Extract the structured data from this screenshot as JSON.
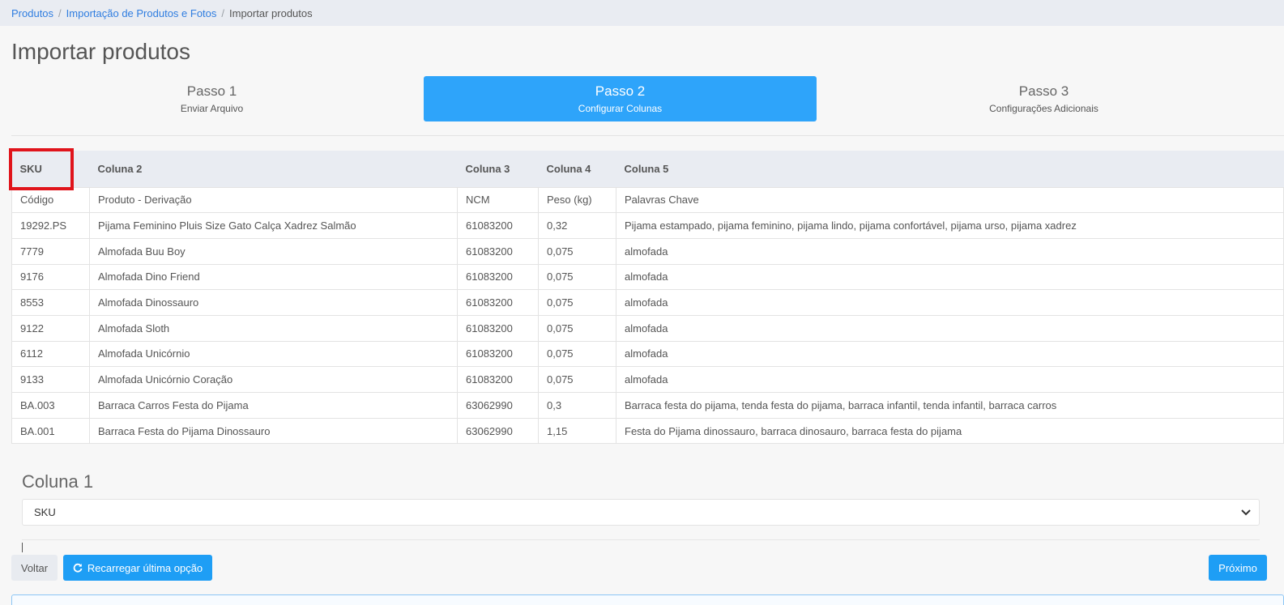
{
  "breadcrumb": {
    "items": [
      {
        "label": "Produtos"
      },
      {
        "label": "Importação de Produtos e Fotos"
      },
      {
        "label": "Importar produtos"
      }
    ]
  },
  "page": {
    "title": "Importar produtos"
  },
  "steps": [
    {
      "number": "Passo 1",
      "label": "Enviar Arquivo",
      "active": false
    },
    {
      "number": "Passo 2",
      "label": "Configurar Colunas",
      "active": true
    },
    {
      "number": "Passo 3",
      "label": "Configurações Adicionais",
      "active": false
    }
  ],
  "table": {
    "headers": [
      "SKU",
      "Coluna 2",
      "Coluna 3",
      "Coluna 4",
      "Coluna 5"
    ],
    "rows": [
      [
        "Código",
        "Produto - Derivação",
        "NCM",
        "Peso (kg)",
        "Palavras Chave"
      ],
      [
        "19292.PS",
        "Pijama Feminino Pluis Size Gato Calça Xadrez Salmão",
        "61083200",
        "0,32",
        "Pijama estampado, pijama feminino, pijama lindo, pijama confortável, pijama urso, pijama xadrez"
      ],
      [
        "7779",
        "Almofada Buu Boy",
        "61083200",
        "0,075",
        "almofada"
      ],
      [
        "9176",
        "Almofada Dino Friend",
        "61083200",
        "0,075",
        "almofada"
      ],
      [
        "8553",
        "Almofada Dinossauro",
        "61083200",
        "0,075",
        "almofada"
      ],
      [
        "9122",
        "Almofada Sloth",
        "61083200",
        "0,075",
        "almofada"
      ],
      [
        "6112",
        "Almofada Unicórnio",
        "61083200",
        "0,075",
        "almofada"
      ],
      [
        "9133",
        "Almofada Unicórnio Coração",
        "61083200",
        "0,075",
        "almofada"
      ],
      [
        "BA.003",
        "Barraca Carros Festa do Pijama",
        "63062990",
        "0,3",
        "Barraca festa do pijama, tenda festa do pijama, barraca infantil, tenda infantil, barraca carros"
      ],
      [
        "BA.001",
        "Barraca Festa do Pijama Dinossauro",
        "63062990",
        "1,15",
        "Festa do Pijama dinossauro, barraca dinosauro, barraca festa do pijama"
      ]
    ]
  },
  "column_config": {
    "title": "Coluna 1",
    "selected": "SKU"
  },
  "buttons": {
    "back": "Voltar",
    "reload": "Recarregar última opção",
    "next": "Próximo"
  },
  "colors": {
    "accent": "#2ea4fa",
    "highlight": "#e0141b",
    "link": "#2f7de0"
  }
}
